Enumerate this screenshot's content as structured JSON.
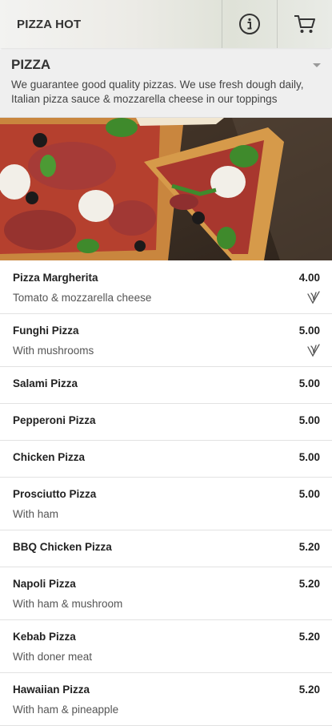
{
  "app": {
    "title": "PIZZA HOT",
    "info_icon": "info-icon",
    "cart_icon": "cart-icon"
  },
  "category": {
    "title": "PIZZA",
    "description": "We guarantee good quality pizzas. We use fresh dough daily, Italian pizza sauce & mozzarella cheese in our toppings",
    "chevron_icon": "chevron-down-icon"
  },
  "colors": {
    "divider": "#e2e2e2",
    "header_bg": "#efefef"
  },
  "items": [
    {
      "name": "Pizza Margherita",
      "price": "4.00",
      "desc": "Tomato & mozzarella cheese",
      "vegetarian": true
    },
    {
      "name": "Funghi Pizza",
      "price": "5.00",
      "desc": "With mushrooms",
      "vegetarian": true
    },
    {
      "name": "Salami Pizza",
      "price": "5.00",
      "desc": "",
      "vegetarian": false
    },
    {
      "name": "Pepperoni Pizza",
      "price": "5.00",
      "desc": "",
      "vegetarian": false
    },
    {
      "name": "Chicken Pizza",
      "price": "5.00",
      "desc": "",
      "vegetarian": false
    },
    {
      "name": "Prosciutto Pizza",
      "price": "5.00",
      "desc": "With ham",
      "vegetarian": false
    },
    {
      "name": "BBQ Chicken Pizza",
      "price": "5.20",
      "desc": "",
      "vegetarian": false
    },
    {
      "name": "Napoli Pizza",
      "price": "5.20",
      "desc": "With ham & mushroom",
      "vegetarian": false
    },
    {
      "name": "Kebab Pizza",
      "price": "5.20",
      "desc": "With doner meat",
      "vegetarian": false
    },
    {
      "name": "Hawaiian Pizza",
      "price": "5.20",
      "desc": "With ham & pineapple",
      "vegetarian": false
    }
  ]
}
